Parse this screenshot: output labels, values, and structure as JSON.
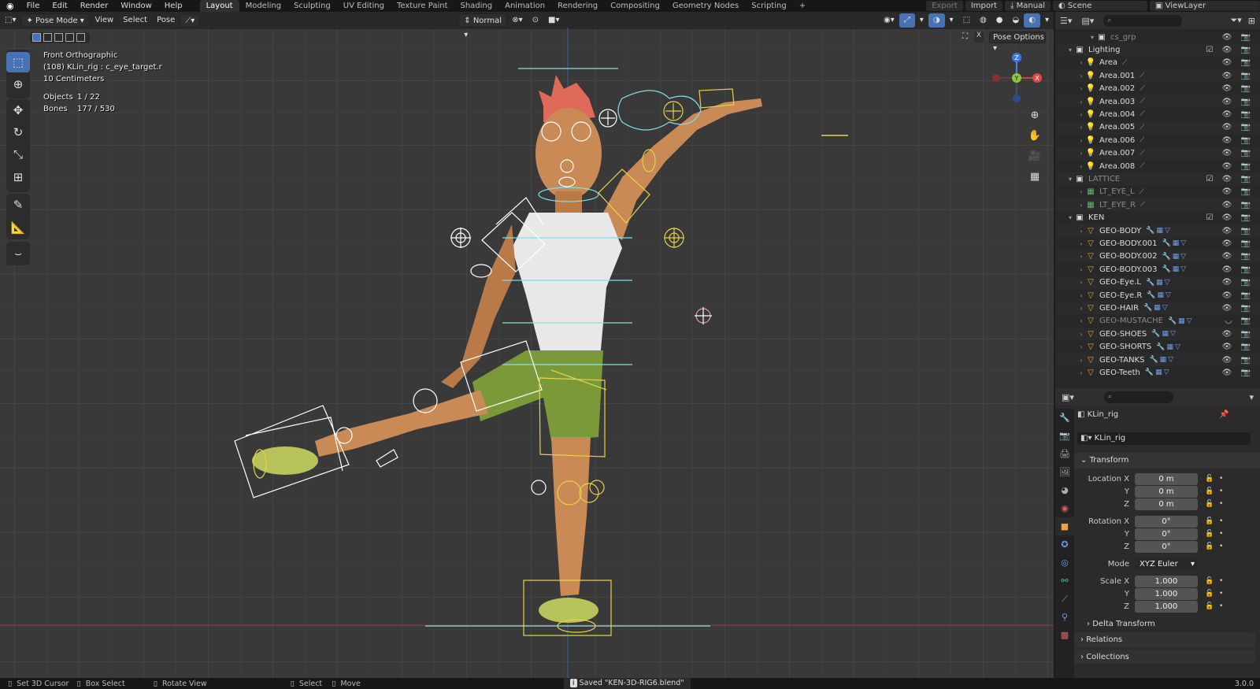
{
  "menu": [
    "File",
    "Edit",
    "Render",
    "Window",
    "Help"
  ],
  "workspaces": [
    "Layout",
    "Modeling",
    "Sculpting",
    "UV Editing",
    "Texture Paint",
    "Shading",
    "Animation",
    "Rendering",
    "Compositing",
    "Geometry Nodes",
    "Scripting"
  ],
  "topright": {
    "export": "Export",
    "import": "Import",
    "manual": "Manual",
    "scene": "Scene",
    "viewlayer": "ViewLayer"
  },
  "viewport": {
    "mode": "Pose Mode",
    "view": "View",
    "select": "Select",
    "pose": "Pose",
    "orientation": "Normal",
    "pose_options": "Pose Options",
    "overlay": {
      "view_name": "Front Orthographic",
      "active": "(108) KLin_rig : c_eye_target.r",
      "scale": "10 Centimeters",
      "objects_label": "Objects",
      "objects_value": "1 / 22",
      "bones_label": "Bones",
      "bones_value": "177 / 530"
    },
    "gizmo": {
      "z": "Z",
      "y": "Y",
      "x": "X"
    }
  },
  "outliner": {
    "rows": [
      {
        "name": "cs_grp",
        "type": "collection",
        "indent": 2,
        "dim": true
      },
      {
        "name": "Lighting",
        "type": "collection",
        "indent": 0,
        "check": true
      },
      {
        "name": "Area",
        "type": "light",
        "indent": 1
      },
      {
        "name": "Area.001",
        "type": "light",
        "indent": 1
      },
      {
        "name": "Area.002",
        "type": "light",
        "indent": 1
      },
      {
        "name": "Area.003",
        "type": "light",
        "indent": 1
      },
      {
        "name": "Area.004",
        "type": "light",
        "indent": 1
      },
      {
        "name": "Area.005",
        "type": "light",
        "indent": 1
      },
      {
        "name": "Area.006",
        "type": "light",
        "indent": 1
      },
      {
        "name": "Area.007",
        "type": "light",
        "indent": 1
      },
      {
        "name": "Area.008",
        "type": "light",
        "indent": 1
      },
      {
        "name": "LATTICE",
        "type": "collection",
        "indent": 0,
        "check": true,
        "dim": true
      },
      {
        "name": "LT_EYE_L",
        "type": "lattice",
        "indent": 1,
        "dim": true
      },
      {
        "name": "LT_EYE_R",
        "type": "lattice",
        "indent": 1,
        "dim": true
      },
      {
        "name": "KEN",
        "type": "collection",
        "indent": 0,
        "check": true
      },
      {
        "name": "GEO-BODY",
        "type": "mesh",
        "indent": 1
      },
      {
        "name": "GEO-BODY.001",
        "type": "mesh",
        "indent": 1
      },
      {
        "name": "GEO-BODY.002",
        "type": "mesh",
        "indent": 1
      },
      {
        "name": "GEO-BODY.003",
        "type": "mesh",
        "indent": 1
      },
      {
        "name": "GEO-Eye.L",
        "type": "mesh",
        "indent": 1
      },
      {
        "name": "GEO-Eye.R",
        "type": "mesh",
        "indent": 1
      },
      {
        "name": "GEO-HAIR",
        "type": "mesh",
        "indent": 1
      },
      {
        "name": "GEO-MUSTACHE",
        "type": "mesh",
        "indent": 1,
        "dim": true
      },
      {
        "name": "GEO-SHOES",
        "type": "mesh",
        "indent": 1
      },
      {
        "name": "GEO-SHORTS",
        "type": "mesh",
        "indent": 1
      },
      {
        "name": "GEO-TANKS",
        "type": "mesh",
        "indent": 1
      },
      {
        "name": "GEO-Teeth",
        "type": "mesh",
        "indent": 1
      }
    ]
  },
  "properties": {
    "object_name": "KLin_rig",
    "datablock": "KLin_rig",
    "transform": "Transform",
    "location_x_label": "Location X",
    "location_x": "0 m",
    "y_label": "Y",
    "location_y": "0 m",
    "z_label": "Z",
    "location_z": "0 m",
    "rotation_x_label": "Rotation X",
    "rotation_x": "0°",
    "rotation_y": "0°",
    "rotation_z": "0°",
    "mode_label": "Mode",
    "mode": "XYZ Euler",
    "scale_x_label": "Scale X",
    "scale_x": "1.000",
    "scale_y": "1.000",
    "scale_z": "1.000",
    "delta": "Delta Transform",
    "relations": "Relations",
    "collections": "Collections"
  },
  "status": {
    "set_cursor": "Set 3D Cursor",
    "box_select": "Box Select",
    "rotate_view": "Rotate View",
    "select": "Select",
    "move": "Move",
    "message": "Saved \"KEN-3D-RIG6.blend\"",
    "version": "3.0.0"
  }
}
